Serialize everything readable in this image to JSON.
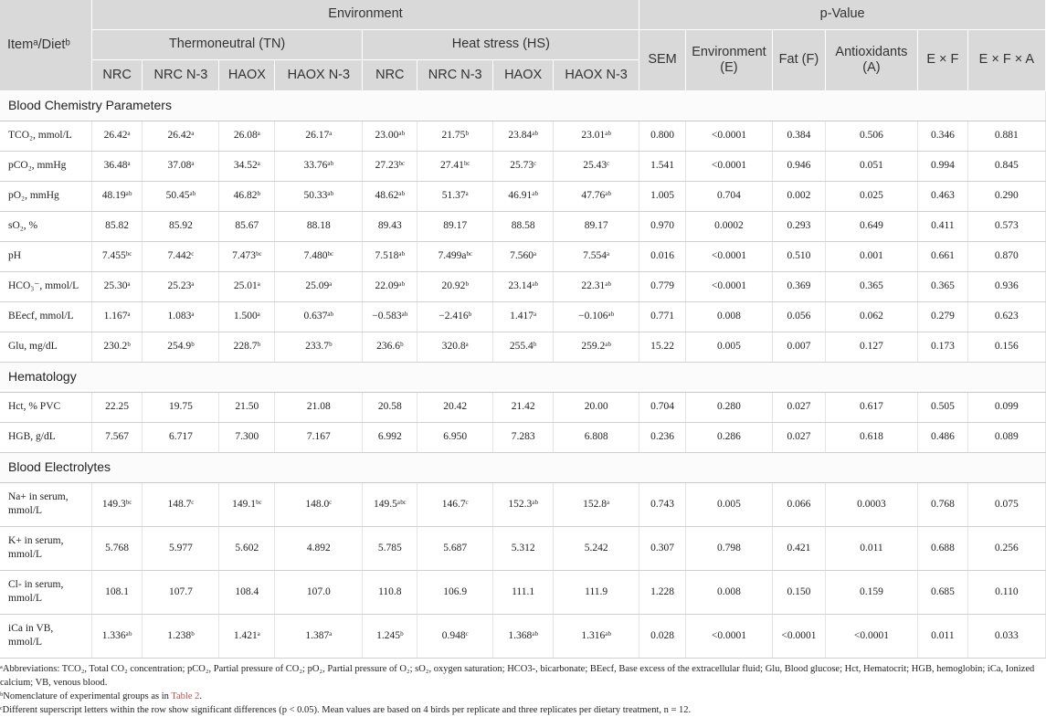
{
  "header": {
    "item_diet": "Itemᵃ/Dietᵇ",
    "environment": "Environment",
    "pvalue": "p-Value",
    "tn": "Thermoneutral (TN)",
    "hs": "Heat stress (HS)",
    "diets": [
      "NRC",
      "NRC N-3",
      "HAOX",
      "HAOX N-3",
      "NRC",
      "NRC N-3",
      "HAOX",
      "HAOX N-3"
    ],
    "stats": [
      "SEM",
      "Environment (E)",
      "Fat (F)",
      "Antioxidants (A)",
      "E × F",
      "E × F × A"
    ]
  },
  "sections": [
    {
      "title": "Blood Chemistry Parameters",
      "rows": [
        {
          "item": "TCO₂, mmol/L",
          "vals": [
            "26.42ᵃ",
            "26.42ᵃ",
            "26.08ᵃ",
            "26.17ᵃ",
            "23.00ᵃᵇ",
            "21.75ᵇ",
            "23.84ᵃᵇ",
            "23.01ᵃᵇ"
          ],
          "stats": [
            "0.800",
            "<0.0001",
            "0.384",
            "0.506",
            "0.346",
            "0.881"
          ]
        },
        {
          "item": "pCO₂, mmHg",
          "vals": [
            "36.48ᵃ",
            "37.08ᵃ",
            "34.52ᵃ",
            "33.76ᵃᵇ",
            "27.23ᵇᶜ",
            "27.41ᵇᶜ",
            "25.73ᶜ",
            "25.43ᶜ"
          ],
          "stats": [
            "1.541",
            "<0.0001",
            "0.946",
            "0.051",
            "0.994",
            "0.845"
          ]
        },
        {
          "item": "pO₂, mmHg",
          "vals": [
            "48.19ᵃᵇ",
            "50.45ᵃᵇ",
            "46.82ᵇ",
            "50.33ᵃᵇ",
            "48.62ᵃᵇ",
            "51.37ᵃ",
            "46.91ᵃᵇ",
            "47.76ᵃᵇ"
          ],
          "stats": [
            "1.005",
            "0.704",
            "0.002",
            "0.025",
            "0.463",
            "0.290"
          ]
        },
        {
          "item": "sO₂, %",
          "vals": [
            "85.82",
            "85.92",
            "85.67",
            "88.18",
            "89.43",
            "89.17",
            "88.58",
            "89.17"
          ],
          "stats": [
            "0.970",
            "0.0002",
            "0.293",
            "0.649",
            "0.411",
            "0.573"
          ]
        },
        {
          "item": "pH",
          "vals": [
            "7.455ᵇᶜ",
            "7.442ᶜ",
            "7.473ᵇᶜ",
            "7.480ᵇᶜ",
            "7.518ᵃᵇ",
            "7.499aᵇᶜ",
            "7.560ᵃ",
            "7.554ᵃ"
          ],
          "stats": [
            "0.016",
            "<0.0001",
            "0.510",
            "0.001",
            "0.661",
            "0.870"
          ]
        },
        {
          "item": "HCO₃⁻, mmol/L",
          "vals": [
            "25.30ᵃ",
            "25.23ᵃ",
            "25.01ᵃ",
            "25.09ᵃ",
            "22.09ᵃᵇ",
            "20.92ᵇ",
            "23.14ᵃᵇ",
            "22.31ᵃᵇ"
          ],
          "stats": [
            "0.779",
            "<0.0001",
            "0.369",
            "0.365",
            "0.365",
            "0.936"
          ]
        },
        {
          "item": "BEecf, mmol/L",
          "vals": [
            "1.167ᵃ",
            "1.083ᵃ",
            "1.500ᵃ",
            "0.637ᵃᵇ",
            "−0.583ᵃᵇ",
            "−2.416ᵇ",
            "1.417ᵃ",
            "−0.106ᵃᵇ"
          ],
          "stats": [
            "0.771",
            "0.008",
            "0.056",
            "0.062",
            "0.279",
            "0.623"
          ]
        },
        {
          "item": "Glu, mg/dL",
          "vals": [
            "230.2ᵇ",
            "254.9ᵇ",
            "228.7ᵇ",
            "233.7ᵇ",
            "236.6ᵇ",
            "320.8ᵃ",
            "255.4ᵇ",
            "259.2ᵃᵇ"
          ],
          "stats": [
            "15.22",
            "0.005",
            "0.007",
            "0.127",
            "0.173",
            "0.156"
          ]
        }
      ]
    },
    {
      "title": "Hematology",
      "rows": [
        {
          "item": "Hct, % PVC",
          "vals": [
            "22.25",
            "19.75",
            "21.50",
            "21.08",
            "20.58",
            "20.42",
            "21.42",
            "20.00"
          ],
          "stats": [
            "0.704",
            "0.280",
            "0.027",
            "0.617",
            "0.505",
            "0.099"
          ]
        },
        {
          "item": "HGB, g/dL",
          "vals": [
            "7.567",
            "6.717",
            "7.300",
            "7.167",
            "6.992",
            "6.950",
            "7.283",
            "6.808"
          ],
          "stats": [
            "0.236",
            "0.286",
            "0.027",
            "0.618",
            "0.486",
            "0.089"
          ]
        }
      ]
    },
    {
      "title": "Blood Electrolytes",
      "rows": [
        {
          "item": "Na+ in serum, mmol/L",
          "vals": [
            "149.3ᵇᶜ",
            "148.7ᶜ",
            "149.1ᵇᶜ",
            "148.0ᶜ",
            "149.5ᵃᵇᶜ",
            "146.7ᶜ",
            "152.3ᵃᵇ",
            "152.8ᵃ"
          ],
          "stats": [
            "0.743",
            "0.005",
            "0.066",
            "0.0003",
            "0.768",
            "0.075"
          ]
        },
        {
          "item": "K+ in serum, mmol/L",
          "vals": [
            "5.768",
            "5.977",
            "5.602",
            "4.892",
            "5.785",
            "5.687",
            "5.312",
            "5.242"
          ],
          "stats": [
            "0.307",
            "0.798",
            "0.421",
            "0.011",
            "0.688",
            "0.256"
          ]
        },
        {
          "item": "Cl- in serum, mmol/L",
          "vals": [
            "108.1",
            "107.7",
            "108.4",
            "107.0",
            "110.8",
            "106.9",
            "111.1",
            "111.9"
          ],
          "stats": [
            "1.228",
            "0.008",
            "0.150",
            "0.159",
            "0.685",
            "0.110"
          ]
        },
        {
          "item": "iCa in VB, mmol/L",
          "vals": [
            "1.336ᵃᵇ",
            "1.238ᵇ",
            "1.421ᵃ",
            "1.387ᵃ",
            "1.245ᵇ",
            "0.948ᶜ",
            "1.368ᵃᵇ",
            "1.316ᵃᵇ"
          ],
          "stats": [
            "0.028",
            "<0.0001",
            "<0.0001",
            "<0.0001",
            "0.011",
            "0.033"
          ]
        }
      ]
    }
  ],
  "footnotes": {
    "a": "ᵃAbbreviations: TCO₂, Total CO₂ concentration; pCO₂, Partial pressure of CO₂; pO₂, Partial pressure of O₂; sO₂, oxygen saturation; HCO3-, bicarbonate; BEecf, Base excess of the extracellular fluid; Glu, Blood glucose; Hct, Hematocrit; HGB, hemoglobin; iCa, Ionized calcium; VB, venous blood.",
    "b_pre": "ᵇNomenclature of experimental groups as in ",
    "b_link": "Table 2",
    "b_post": ".",
    "c": "ᶜDifferent superscript letters within the row show significant differences (p < 0.05). Mean values are based on 4 birds per replicate and three replicates per dietary treatment, n = 12."
  }
}
